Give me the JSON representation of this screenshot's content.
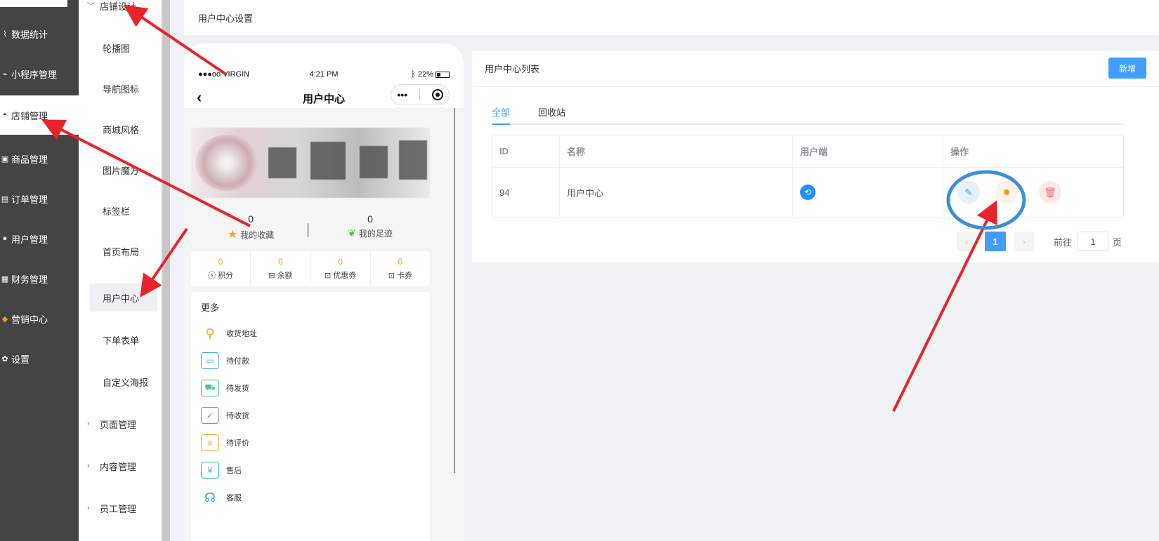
{
  "sidebar": {
    "items": [
      {
        "label": "数据统计",
        "icon": "chart-icon"
      },
      {
        "label": "小程序管理",
        "icon": "miniapp-icon"
      },
      {
        "label": "店铺管理",
        "icon": "shop-icon"
      },
      {
        "label": "商品管理",
        "icon": "goods-icon"
      },
      {
        "label": "订单管理",
        "icon": "order-icon"
      },
      {
        "label": "用户管理",
        "icon": "user-icon"
      },
      {
        "label": "财务管理",
        "icon": "finance-icon"
      },
      {
        "label": "营销中心",
        "icon": "marketing-icon"
      },
      {
        "label": "设置",
        "icon": "gear-icon"
      }
    ]
  },
  "submenu": {
    "group_shop_design": "店铺设计",
    "items": [
      "轮播图",
      "导航图标",
      "商城风格",
      "图片魔方",
      "标签栏",
      "首页布局",
      "用户中心",
      "下单表单",
      "自定义海报"
    ],
    "groups": [
      "页面管理",
      "内容管理",
      "员工管理"
    ]
  },
  "topbar": {
    "title": "用户中心设置"
  },
  "phone": {
    "carrier": "●●●oo VIRGIN",
    "time": "4:21 PM",
    "battery": "22%",
    "title": "用户中心",
    "stats": [
      {
        "num": "0",
        "label": "我的收藏"
      },
      {
        "num": "0",
        "label": "我的足迹"
      }
    ],
    "assets": [
      {
        "num": "0",
        "label": "积分"
      },
      {
        "num": "0",
        "label": "余额"
      },
      {
        "num": "0",
        "label": "优惠券"
      },
      {
        "num": "0",
        "label": "卡券"
      }
    ],
    "more_title": "更多",
    "more_items": [
      "收货地址",
      "待付款",
      "待发货",
      "待收货",
      "待评价",
      "售后",
      "客服"
    ]
  },
  "panel": {
    "title": "用户中心列表",
    "new_button": "新增",
    "tabs": [
      "全部",
      "回收站"
    ],
    "columns": [
      "ID",
      "名称",
      "用户端",
      "操作"
    ],
    "rows": [
      {
        "id": "94",
        "name": "用户中心"
      }
    ],
    "pager": {
      "current": "1",
      "goto_label": "前往",
      "page_input": "1",
      "page_suffix": "页"
    }
  },
  "colors": {
    "primary": "#409eff",
    "sidebar": "#444444",
    "annotation": "#e8232a",
    "circle": "#3b8fd8"
  }
}
